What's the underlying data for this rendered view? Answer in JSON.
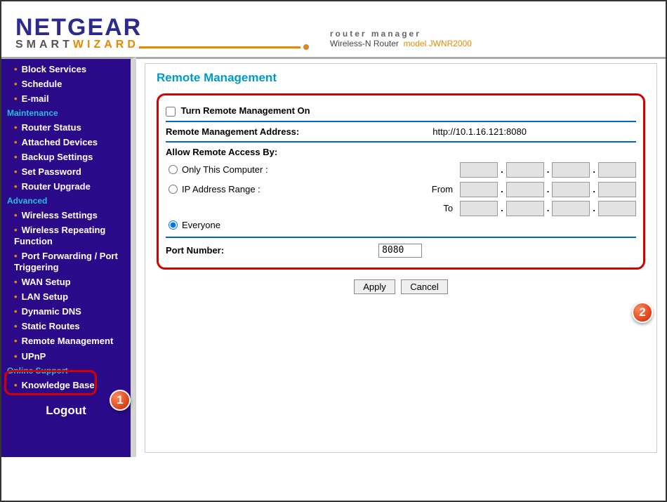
{
  "brand": {
    "name": "NETGEAR",
    "sub1": "SMART",
    "sub2": "WIZARD"
  },
  "subhead": {
    "line1": "router manager",
    "line2a": "Wireless-N Router",
    "line2b": "model JWNR2000"
  },
  "sidebar": {
    "items": [
      {
        "label": "Block Services"
      },
      {
        "label": "Schedule"
      },
      {
        "label": "E-mail"
      }
    ],
    "maintenance_heading": "Maintenance",
    "maintenance": [
      {
        "label": "Router Status"
      },
      {
        "label": "Attached Devices"
      },
      {
        "label": "Backup Settings"
      },
      {
        "label": "Set Password"
      },
      {
        "label": "Router Upgrade"
      }
    ],
    "advanced_heading": "Advanced",
    "advanced": [
      {
        "label": "Wireless Settings"
      },
      {
        "label": "Wireless Repeating Function"
      },
      {
        "label": "Port Forwarding / Port Triggering"
      },
      {
        "label": "WAN Setup"
      },
      {
        "label": "LAN Setup"
      },
      {
        "label": "Dynamic DNS"
      },
      {
        "label": "Static Routes"
      },
      {
        "label": "Remote Management"
      },
      {
        "label": "UPnP"
      }
    ],
    "support_heading": "Online Support",
    "support": [
      {
        "label": "Knowledge Base"
      }
    ],
    "logout": "Logout"
  },
  "content": {
    "title": "Remote Management",
    "enable_label": "Turn Remote Management On",
    "rm_addr_label": "Remote Management Address:",
    "rm_addr_value": "http://10.1.16.121:8080",
    "allow_label": "Allow Remote Access By:",
    "only_this": "Only This Computer :",
    "ip_range": "IP Address Range :",
    "from": "From",
    "to": "To",
    "everyone": "Everyone",
    "port_label": "Port Number:",
    "port_value": "8080",
    "apply": "Apply",
    "cancel": "Cancel"
  },
  "badges": {
    "one": "1",
    "two": "2"
  }
}
